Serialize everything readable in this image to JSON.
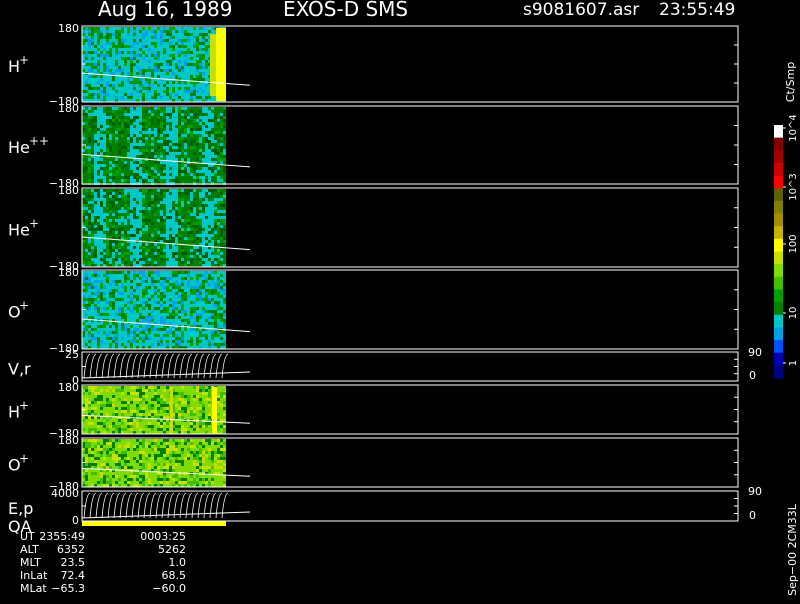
{
  "header": {
    "date": "Aug 16, 1989",
    "instrument": "EXOS-D SMS",
    "file": "s9081607.asr",
    "time": "23:55:49"
  },
  "colorbar": {
    "unit": "Ct/Smp",
    "tick_labels": [
      "1",
      "10",
      "100",
      "10^3",
      "10^4"
    ],
    "colors": [
      "#000080",
      "#0000b4",
      "#0050ff",
      "#00a0e6",
      "#00c8c8",
      "#008000",
      "#00a000",
      "#40c000",
      "#80dc00",
      "#c8e000",
      "#ffff00",
      "#c8b400",
      "#a09000",
      "#808000",
      "#606000",
      "#ff0000",
      "#cc0000",
      "#a00000",
      "#800000",
      "#ffffff"
    ]
  },
  "panels": [
    {
      "id": "h-plus-1",
      "label": "H",
      "sup": "+",
      "ytop": "180",
      "ybot": "−180",
      "rtop": "",
      "rbot": ""
    },
    {
      "id": "he-plusplus",
      "label": "He",
      "sup": "++",
      "ytop": "180",
      "ybot": "−180",
      "rtop": "",
      "rbot": ""
    },
    {
      "id": "he-plus",
      "label": "He",
      "sup": "+",
      "ytop": "180",
      "ybot": "−180",
      "rtop": "",
      "rbot": ""
    },
    {
      "id": "o-plus-1",
      "label": "O",
      "sup": "+",
      "ytop": "180",
      "ybot": "−180",
      "rtop": "",
      "rbot": ""
    },
    {
      "id": "v-r",
      "label": "V,r",
      "sup": "",
      "ytop": "25",
      "ybot": "0",
      "rtop": "90",
      "rbot": "0"
    },
    {
      "id": "h-plus-2",
      "label": "H",
      "sup": "+",
      "ytop": "180",
      "ybot": "−180",
      "rtop": "",
      "rbot": ""
    },
    {
      "id": "o-plus-2",
      "label": "O",
      "sup": "+",
      "ytop": "180",
      "ybot": "−180",
      "rtop": "",
      "rbot": ""
    },
    {
      "id": "e-p",
      "label": "E,p",
      "sup": "",
      "label2": "QA",
      "ytop": "4000",
      "ybot": "0",
      "rtop": "90",
      "rbot": "0"
    }
  ],
  "side_note": "Sep−00 2CM33L",
  "orbit_table": {
    "rows": [
      {
        "label": "UT",
        "v1": "2355:49",
        "v2": "0003:25"
      },
      {
        "label": "ALT",
        "v1": "6352",
        "v2": "5262"
      },
      {
        "label": "MLT",
        "v1": "23.5",
        "v2": "1.0"
      },
      {
        "label": "InLat",
        "v1": "72.4",
        "v2": "68.5"
      },
      {
        "label": "MLat",
        "v1": "−65.3",
        "v2": "−60.0"
      }
    ]
  },
  "chart_data": {
    "type": "heatmap",
    "title": "Aug 16, 1989   EXOS-D SMS",
    "x_ticks": [
      "2355:49",
      "0003:25"
    ],
    "data_extent_fraction": 0.22,
    "series": [
      {
        "name": "H+",
        "dominant_color": "#00c8c8"
      },
      {
        "name": "He++",
        "dominant_color": "#008000"
      },
      {
        "name": "He+",
        "dominant_color": "#008000"
      },
      {
        "name": "O+",
        "dominant_color": "#00c8c8"
      },
      {
        "name": "V,r",
        "dominant_color": "#ffffff"
      },
      {
        "name": "H+",
        "dominant_color": "#80dc00"
      },
      {
        "name": "O+",
        "dominant_color": "#80dc00"
      },
      {
        "name": "E,p",
        "dominant_color": "#ffffff"
      }
    ]
  }
}
